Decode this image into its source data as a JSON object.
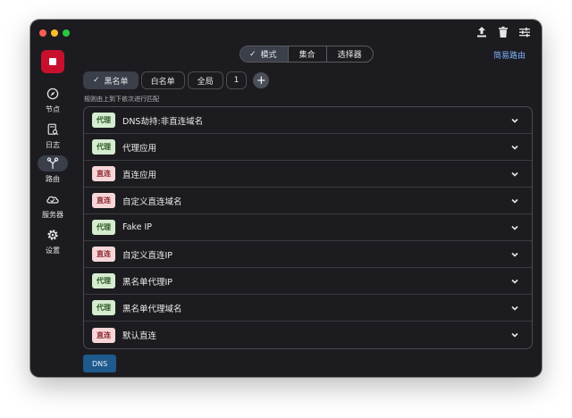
{
  "toolbar": {
    "upload_icon": "upload-icon",
    "trash_icon": "trash-icon",
    "settings_icon": "sliders-icon"
  },
  "sidebar": {
    "items": [
      {
        "label": "节点",
        "icon": "compass-icon"
      },
      {
        "label": "日志",
        "icon": "log-icon"
      },
      {
        "label": "路由",
        "icon": "route-icon",
        "active": true
      },
      {
        "label": "服务器",
        "icon": "cloud-icon"
      },
      {
        "label": "设置",
        "icon": "gear-icon"
      }
    ]
  },
  "mode_tabs": [
    {
      "label": "模式",
      "active": true
    },
    {
      "label": "集合"
    },
    {
      "label": "选择器"
    }
  ],
  "simple_route": "简易路由",
  "filters": {
    "blacklist": "黑名单",
    "whitelist": "白名单",
    "global": "全局",
    "count": "1"
  },
  "hint": "规则由上到下依次进行匹配",
  "rules": [
    {
      "tag": "代理",
      "type": "proxy",
      "name": "DNS劫持:非直连域名"
    },
    {
      "tag": "代理",
      "type": "proxy",
      "name": "代理应用"
    },
    {
      "tag": "直连",
      "type": "direct",
      "name": "直连应用"
    },
    {
      "tag": "直连",
      "type": "direct",
      "name": "自定义直连域名"
    },
    {
      "tag": "代理",
      "type": "proxy",
      "name": "Fake IP"
    },
    {
      "tag": "直连",
      "type": "direct",
      "name": "自定义直连IP"
    },
    {
      "tag": "代理",
      "type": "proxy",
      "name": "黑名单代理IP"
    },
    {
      "tag": "代理",
      "type": "proxy",
      "name": "黑名单代理域名"
    },
    {
      "tag": "直连",
      "type": "direct",
      "name": "默认直连"
    }
  ],
  "dns_button": "DNS",
  "colors": {
    "accent": "#7fb3ff",
    "stop": "#c8102e",
    "proxy_badge": "#d5ecd0",
    "direct_badge": "#f7d6d9",
    "dns": "#1f5a8c"
  }
}
